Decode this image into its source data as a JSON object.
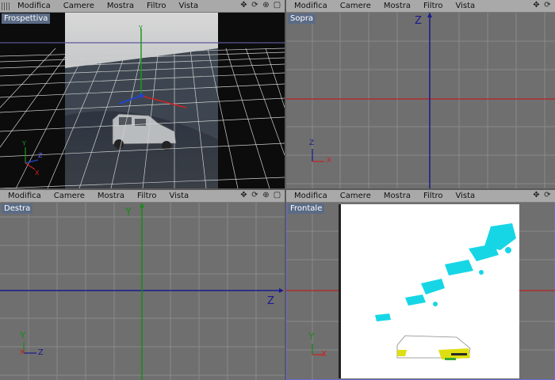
{
  "menu": [
    "Modifica",
    "Camere",
    "Mostra",
    "Filtro",
    "Vista"
  ],
  "tools": [
    "move-icon",
    "rotate-icon",
    "zoom-icon",
    "maximize-icon"
  ],
  "viewports": {
    "perspective": {
      "label": "Frospettiva"
    },
    "top": {
      "label": "Sopra",
      "axis_label": "Z",
      "gizmo": {
        "up": "Z",
        "right": "X"
      }
    },
    "right": {
      "label": "Destra",
      "axis_v": "Y",
      "axis_h": "Z",
      "gizmo": {
        "up": "Y",
        "right": "Z"
      }
    },
    "front": {
      "label": "Frontale",
      "gizmo": {
        "up": "Y",
        "right": "X"
      }
    }
  },
  "colors": {
    "axis_x": "#cc2222",
    "axis_y": "#1a8a1a",
    "axis_z": "#1a1aa0",
    "label_bg": "#5b6b86"
  }
}
